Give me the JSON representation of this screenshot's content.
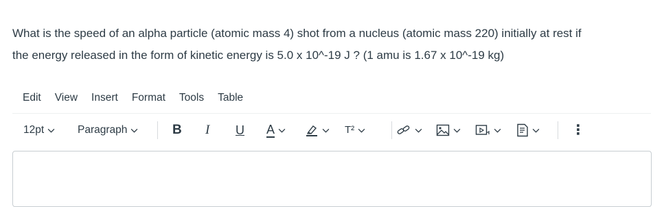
{
  "question": {
    "line1": "What is the speed of an alpha particle (atomic mass 4) shot from a nucleus (atomic mass 220) initially at rest if",
    "line2": "the energy released in the form of kinetic energy is 5.0 x 10^-19 J ? (1 amu is 1.67 x 10^-19 kg)"
  },
  "menubar": {
    "edit": "Edit",
    "view": "View",
    "insert": "Insert",
    "format": "Format",
    "tools": "Tools",
    "table": "Table"
  },
  "toolbar": {
    "font_size": "12pt",
    "block_format": "Paragraph",
    "bold": "B",
    "italic": "I",
    "underline": "U",
    "text_color": "A",
    "superscript": "T²",
    "more": "⋮",
    "icons": [
      "bold-icon",
      "italic-icon",
      "underline-icon",
      "text-color-icon",
      "highlight-icon",
      "superscript-icon",
      "link-icon",
      "image-icon",
      "media-icon",
      "document-icon",
      "more-icon"
    ]
  },
  "colors": {
    "text": "#2d3b45",
    "border": "#c7cdd1",
    "icon": "#2d3b45"
  },
  "editor": {
    "value": ""
  }
}
